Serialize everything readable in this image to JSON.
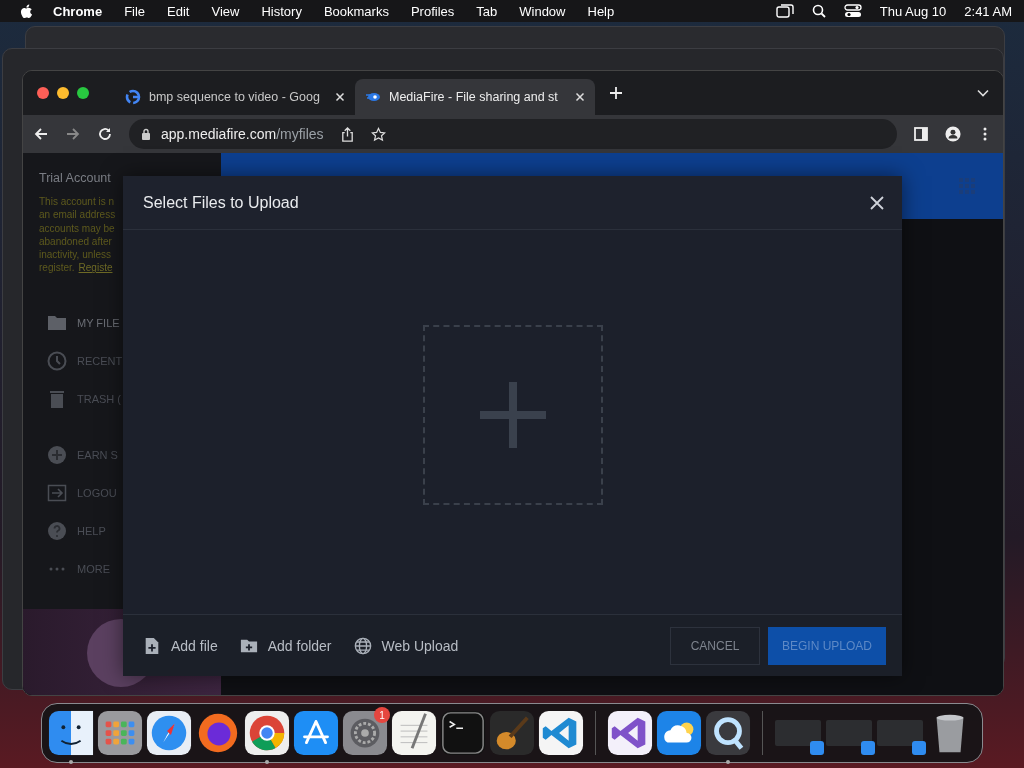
{
  "menu_bar": {
    "app": "Chrome",
    "items": [
      "File",
      "Edit",
      "View",
      "History",
      "Bookmarks",
      "Profiles",
      "Tab",
      "Window",
      "Help"
    ],
    "date": "Thu Aug 10",
    "time": "2:41 AM"
  },
  "browser": {
    "tabs": [
      {
        "title": "bmp sequence to video - Goog",
        "selected": false
      },
      {
        "title": "MediaFire - File sharing and st",
        "selected": true
      }
    ],
    "address": {
      "host": "app.mediafire.com",
      "path": "/myfiles"
    }
  },
  "sidebar": {
    "account": "Trial Account",
    "notice_lines": [
      "This account is n",
      "an email address",
      "accounts may be",
      "abandoned after",
      "inactivity, unless"
    ],
    "notice_last": "register.",
    "notice_link": "Registe",
    "sections": [
      [
        {
          "label": "MY FILE",
          "kind": "folder"
        },
        {
          "label": "RECENT",
          "kind": "clock"
        },
        {
          "label": "TRASH (",
          "kind": "trash"
        }
      ],
      [
        {
          "label": "EARN S",
          "kind": "plus"
        },
        {
          "label": "LOGOU",
          "kind": "logout"
        },
        {
          "label": "HELP",
          "kind": "help"
        },
        {
          "label": "MORE",
          "kind": "more"
        }
      ]
    ]
  },
  "dialog": {
    "title": "Select Files to Upload",
    "actions": [
      {
        "label": "Add file",
        "kind": "file"
      },
      {
        "label": "Add folder",
        "kind": "folder"
      },
      {
        "label": "Web Upload",
        "kind": "globe"
      }
    ],
    "cancel": "CANCEL",
    "submit": "BEGIN UPLOAD"
  },
  "dock": {
    "badge": "1"
  }
}
